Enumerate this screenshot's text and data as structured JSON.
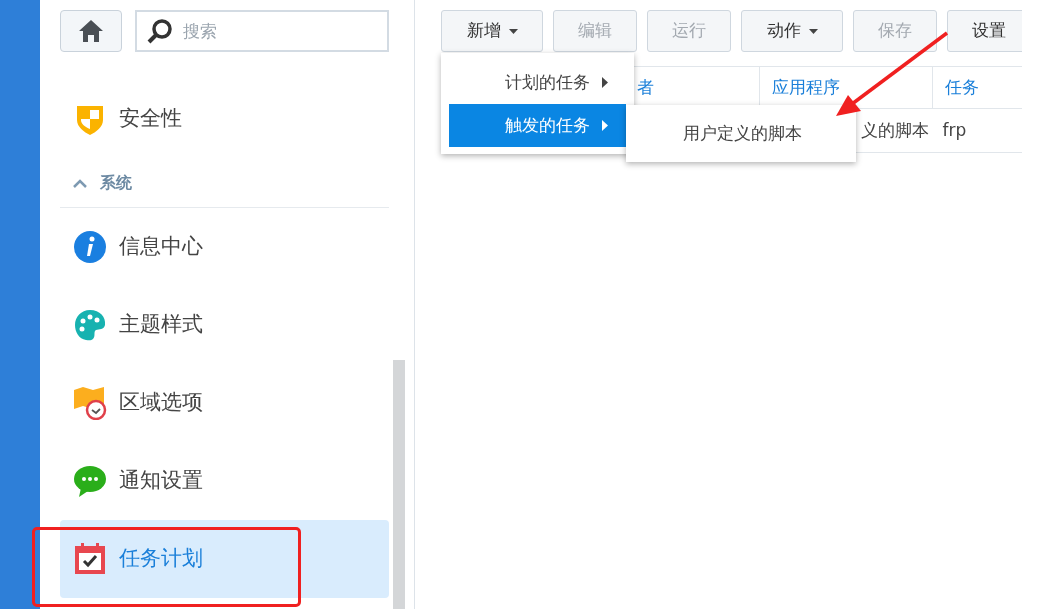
{
  "sidebar": {
    "search": {
      "placeholder": "搜索"
    },
    "items": [
      {
        "kind": "item",
        "label": "安全性",
        "selected": false
      },
      {
        "kind": "section",
        "label": "系统",
        "expanded": true
      },
      {
        "kind": "item",
        "label": "信息中心",
        "selected": false
      },
      {
        "kind": "item",
        "label": "主题样式",
        "selected": false
      },
      {
        "kind": "item",
        "label": "区域选项",
        "selected": false
      },
      {
        "kind": "item",
        "label": "通知设置",
        "selected": false
      },
      {
        "kind": "item",
        "label": "任务计划",
        "selected": true
      }
    ]
  },
  "toolbar": {
    "buttons": [
      {
        "label": "新增",
        "disabled": false,
        "dropdown": true
      },
      {
        "label": "编辑",
        "disabled": true,
        "dropdown": false
      },
      {
        "label": "运行",
        "disabled": true,
        "dropdown": false
      },
      {
        "label": "动作",
        "disabled": false,
        "dropdown": true
      },
      {
        "label": "保存",
        "disabled": true,
        "dropdown": false
      },
      {
        "label": "设置",
        "disabled": false,
        "dropdown": false
      }
    ]
  },
  "table": {
    "columns": [
      "者",
      "应用程序",
      "任务"
    ],
    "rows": [
      {
        "column_2": "义的脚本",
        "column_3": "frp"
      }
    ]
  },
  "menu": {
    "items": [
      {
        "label": "计划的任务",
        "selected": false,
        "submenu": true
      },
      {
        "label": "触发的任务",
        "selected": true,
        "submenu": true
      }
    ],
    "submenu": {
      "items": [
        {
          "label": "用户定义的脚本"
        }
      ]
    }
  },
  "annotations": [
    {
      "kind": "box"
    },
    {
      "kind": "arrow"
    }
  ]
}
